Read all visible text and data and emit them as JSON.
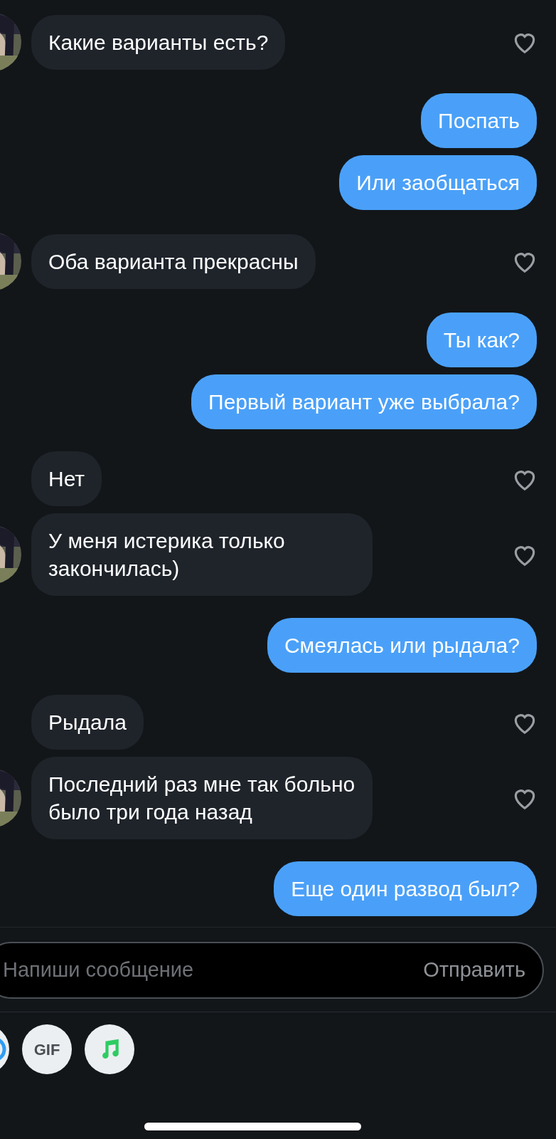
{
  "messages": [
    {
      "kind": "incoming",
      "text": "Какие варианты есть?",
      "avatar": true
    },
    {
      "kind": "outgoing",
      "text": "Поспать"
    },
    {
      "kind": "outgoing",
      "text": "Или заобщаться"
    },
    {
      "kind": "incoming",
      "text": "Оба варианта прекрасны",
      "avatar": true
    },
    {
      "kind": "outgoing",
      "text": "Ты как?"
    },
    {
      "kind": "outgoing",
      "text": "Первый вариант уже выбрала?"
    },
    {
      "kind": "incoming",
      "text": "Нет",
      "avatar": false
    },
    {
      "kind": "incoming",
      "text": "У меня истерика только закончилась)",
      "avatar": true
    },
    {
      "kind": "outgoing",
      "text": "Смеялась или рыдала?"
    },
    {
      "kind": "incoming",
      "text": "Рыдала",
      "avatar": false
    },
    {
      "kind": "incoming",
      "text": "Последний раз мне так больно было три года назад",
      "avatar": true
    },
    {
      "kind": "outgoing",
      "text": "Еще один развод был?"
    }
  ],
  "composer": {
    "placeholder": "Напиши сообщение",
    "send_button": "Отправить"
  },
  "attachments": [
    {
      "kind": "partial"
    },
    {
      "kind": "gif",
      "label": "GIF"
    },
    {
      "kind": "music"
    }
  ]
}
